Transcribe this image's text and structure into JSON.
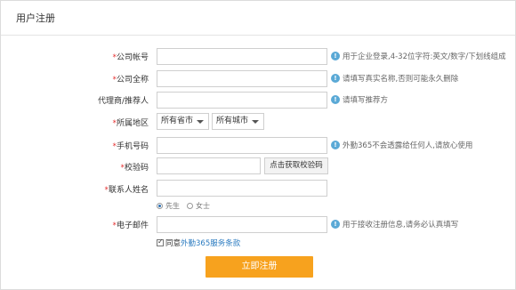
{
  "page": {
    "title": "用户注册"
  },
  "form": {
    "company_account": {
      "label": "公司帐号",
      "required": true,
      "hint": "用于企业登录,4-32位字符:英文/数字/下划线组成"
    },
    "company_name": {
      "label": "公司全称",
      "required": true,
      "hint": "请填写真实名称,否则可能永久删除"
    },
    "referrer": {
      "label": "代理商/推荐人",
      "required": false,
      "hint": "请填写推荐方"
    },
    "region": {
      "label": "所属地区",
      "required": true,
      "province": "所有省市",
      "city": "所有城市"
    },
    "phone": {
      "label": "手机号码",
      "required": true,
      "hint": "外勤365不会透露给任何人,请放心使用"
    },
    "captcha": {
      "label": "校验码",
      "required": true,
      "button": "点击获取校验码"
    },
    "contact_name": {
      "label": "联系人姓名",
      "required": true
    },
    "gender": {
      "male": "先生",
      "female": "女士",
      "selected": "male"
    },
    "email": {
      "label": "电子邮件",
      "required": true,
      "hint": "用于接收注册信息,请务必认真填写"
    },
    "agree": {
      "prefix": "同意",
      "terms": "外勤365服务条款",
      "checked": true
    },
    "submit": "立即注册"
  },
  "colors": {
    "accent": "#f7a21e",
    "required": "#e53333",
    "link": "#2b7bc0",
    "info": "#5aa9d6"
  }
}
